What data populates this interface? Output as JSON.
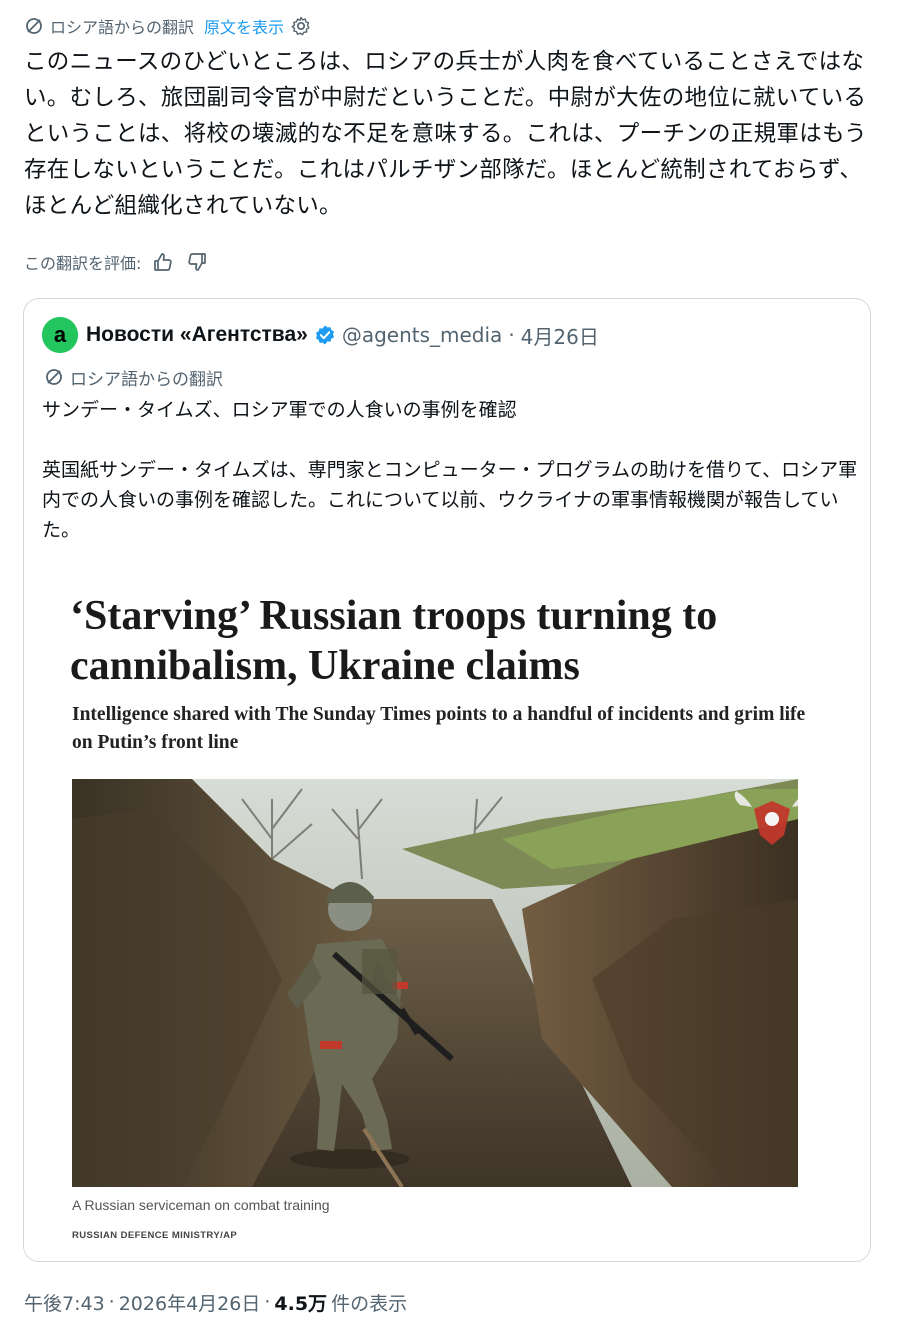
{
  "translation_header": {
    "label": "ロシア語からの翻訳",
    "show_original": "原文を表示"
  },
  "post": {
    "text": "このニュースのひどいところは、ロシアの兵士が人肉を食べていることさえではない。むしろ、旅団副司令官が中尉だということだ。中尉が大佐の地位に就いているということは、将校の壊滅的な不足を意味する。これは、プーチンの正規軍はもう存在しないということだ。これはパルチザン部隊だ。ほとんど統制されておらず、ほとんど組織化されていない。",
    "rate_label": "この翻訳を評価:"
  },
  "quoted": {
    "avatar_letter": "a",
    "name": "Новости «Агентства»",
    "handle": "@agents_media",
    "separator": "·",
    "date": "4月26日",
    "translation_label": "ロシア語からの翻訳",
    "text": "サンデー・タイムズ、ロシア軍での人食いの事例を確認\n\n英国紙サンデー・タイムズは、専門家とコンピューター・プログラムの助けを借りて、ロシア軍内での人食いの事例を確認した。これについて以前、ウクライナの軍事情報機関が報告していた。",
    "article": {
      "headline": "‘Starving’ Russian troops turning to cannibalism, Ukraine claims",
      "subhead": "Intelligence shared with The Sunday Times points to a handful of incidents and grim life on Putin’s front line",
      "caption": "A Russian serviceman on combat training",
      "credit": "RUSSIAN DEFENCE MINISTRY/AP"
    }
  },
  "meta": {
    "time": "午後7:43",
    "sep1": "·",
    "date": "2026年4月26日",
    "sep2": "·",
    "views": "4.5万",
    "views_label": "件の表示"
  },
  "colors": {
    "link": "#1d9bf0",
    "muted": "#536471",
    "verified": "#1d9bf0",
    "avatar": "#22c55e"
  },
  "icons": [
    "translate-icon",
    "gear-icon",
    "thumbs-up-icon",
    "thumbs-down-icon",
    "verified-badge-icon",
    "defence-ministry-emblem-icon"
  ]
}
